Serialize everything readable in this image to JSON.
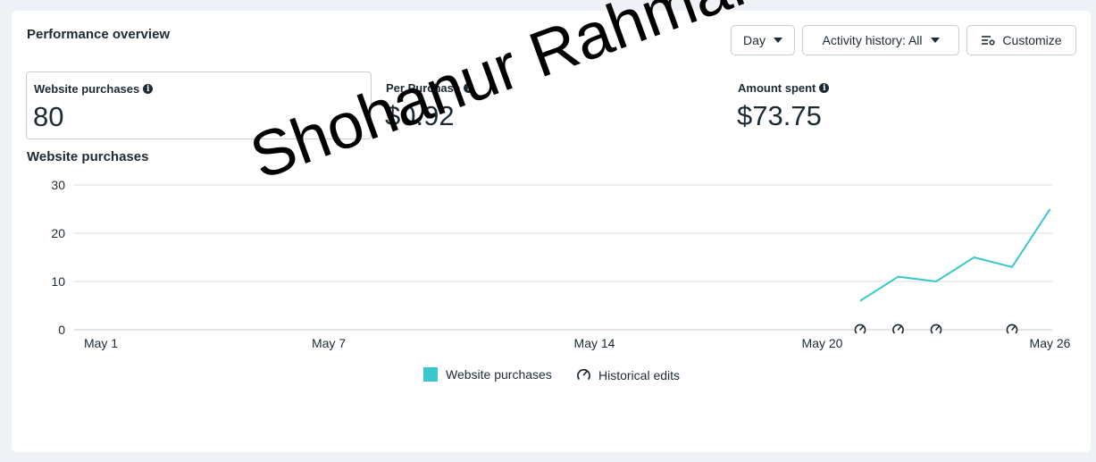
{
  "header": {
    "title": "Performance overview",
    "day_label": "Day",
    "activity_label": "Activity history: All",
    "customize_label": "Customize"
  },
  "metrics": [
    {
      "label": "Website purchases",
      "value": "80"
    },
    {
      "label": "Per Purchase",
      "value": "$0.92"
    },
    {
      "label": "Amount spent",
      "value": "$73.75"
    }
  ],
  "chart_title": "Website purchases",
  "chart_data": {
    "type": "line",
    "x": [
      "May 21",
      "May 22",
      "May 23",
      "May 24",
      "May 25",
      "May 26"
    ],
    "series": [
      {
        "name": "Website purchases",
        "values": [
          6,
          11,
          10,
          15,
          13,
          25
        ]
      }
    ],
    "x_tick_labels": [
      "May 1",
      "May 7",
      "May 14",
      "May 20",
      "May 26"
    ],
    "y_ticks": [
      0,
      10,
      20,
      30
    ],
    "ylim": [
      0,
      30
    ],
    "historical_edit_dates": [
      "May 21",
      "May 22",
      "May 23",
      "May 25"
    ],
    "grid": true,
    "legend": "bottom-center"
  },
  "legend": {
    "series_label": "Website purchases",
    "edits_label": "Historical edits"
  },
  "watermark": "Shohanur Rahman",
  "colors": {
    "series": "#3ac8cc",
    "grid": "#dadde1",
    "text": "#1c2b33"
  }
}
